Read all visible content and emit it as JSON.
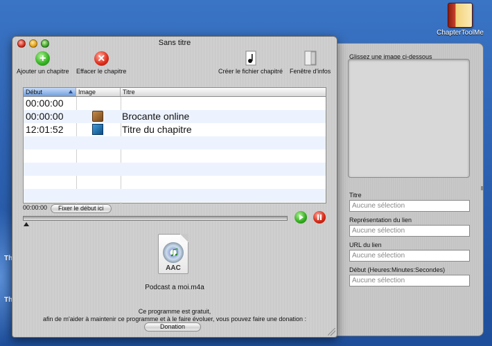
{
  "desktop": {
    "icon_label": "ChapterToolMe",
    "side_text_1": "Th",
    "side_text_2": "Th"
  },
  "window": {
    "title": "Sans titre"
  },
  "toolbar": {
    "add_label": "Ajouter un chapitre",
    "remove_label": "Effacer le chapitre",
    "create_label": "Créer le fichier chapitré",
    "info_label": "Fenêtre d'infos"
  },
  "table": {
    "columns": [
      "Début",
      "Image",
      "Titre"
    ],
    "rows": [
      {
        "start": "00:00:00",
        "image": "",
        "title": ""
      },
      {
        "start": "00:00:00",
        "image": "box-thumbnail",
        "title": "Brocante online"
      },
      {
        "start": "12:01:52",
        "image": "photo-thumbnail",
        "title": "Titre du chapitre"
      }
    ]
  },
  "timeline": {
    "current_time": "00:00:00",
    "set_start_label": "Fixer le début ici",
    "position": 0
  },
  "file": {
    "badge": "AAC",
    "name": "Podcast a moi.m4a"
  },
  "donation": {
    "line1": "Ce programme est gratuit,",
    "line2": "afin de m'aider à maintenir ce programme et à le faire évoluer, vous pouvez faire une donation :",
    "button_label": "Donation"
  },
  "drawer": {
    "drop_label": "Glissez une image ci-dessous",
    "fields": [
      {
        "label": "Titre",
        "placeholder": "Aucune sélection"
      },
      {
        "label": "Représentation du lien",
        "placeholder": "Aucune sélection"
      },
      {
        "label": "URL du lien",
        "placeholder": "Aucune sélection"
      },
      {
        "label": "Début (Heures:Minutes:Secondes)",
        "placeholder": "Aucune sélection"
      }
    ]
  }
}
